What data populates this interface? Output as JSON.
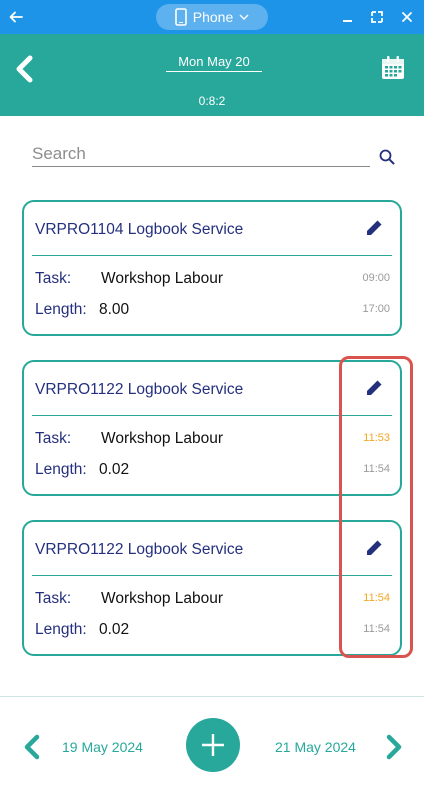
{
  "window": {
    "device_label": "Phone",
    "colors": {
      "titlebar": "#1e94e8",
      "accent": "#27a89b",
      "highlight_time": "#f5a623",
      "callout": "#d9534f"
    },
    "icons": [
      "arrow-left-icon",
      "phone-icon",
      "chevron-down-icon",
      "minimize-icon",
      "maximize-icon",
      "close-icon"
    ]
  },
  "header": {
    "date": "Mon May 20",
    "time": "0:8:2",
    "icons": [
      "back-chevron-icon",
      "calendar-icon"
    ]
  },
  "search": {
    "placeholder": "Search",
    "value": ""
  },
  "entries": [
    {
      "title": "VRPRO1104 Logbook Service",
      "task_label": "Task:",
      "task_value": "Workshop Labour",
      "length_label": "Length:",
      "length_value": "8.00",
      "start_time": "09:00",
      "end_time": "17:00"
    },
    {
      "title": "VRPRO1122 Logbook Service",
      "task_label": "Task:",
      "task_value": "Workshop Labour",
      "length_label": "Length:",
      "length_value": "0.02",
      "start_time": "11:53",
      "end_time": "11:54"
    },
    {
      "title": "VRPRO1122 Logbook Service",
      "task_label": "Task:",
      "task_value": "Workshop Labour",
      "length_label": "Length:",
      "length_value": "0.02",
      "start_time": "11:54",
      "end_time": "11:54"
    }
  ],
  "footer": {
    "prev_date": "19 May 2024",
    "next_date": "21 May 2024"
  }
}
